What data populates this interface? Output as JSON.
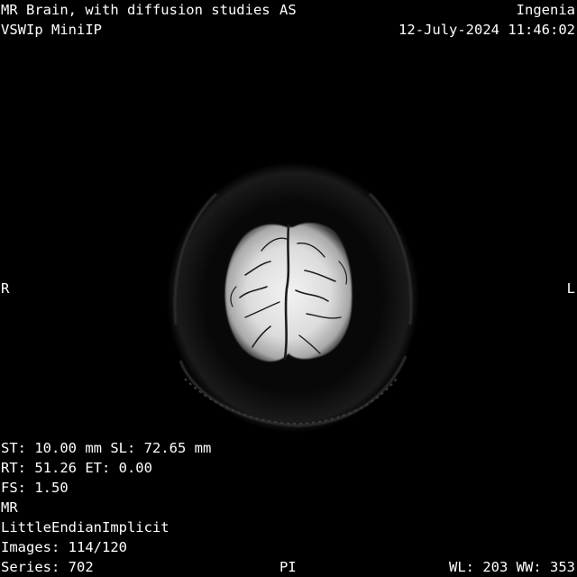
{
  "viewer": {
    "study_description": "MR Brain, with diffusion studies",
    "series_description": "VSWIp MiniIP",
    "manufacturer_model": "Ingenia",
    "study_datetime": "12-July-2024 11:46:02",
    "slice_info": "ST: 10.00 mm SL: 72.65 mm",
    "timing_info": "RT: 51.26 ET: 0.00",
    "field_strength": "FS: 1.50",
    "modality": "MR",
    "transfer_syntax": "LittleEndianImplicit",
    "images": "Images: 114/120",
    "series": "Series: 702",
    "window": "WL: 203 WW: 353"
  },
  "orientation": {
    "top": "AS",
    "left": "R",
    "right": "L",
    "bottom": "PI"
  },
  "colors": {
    "background": "#000000",
    "overlay_text": "#ffffff"
  }
}
